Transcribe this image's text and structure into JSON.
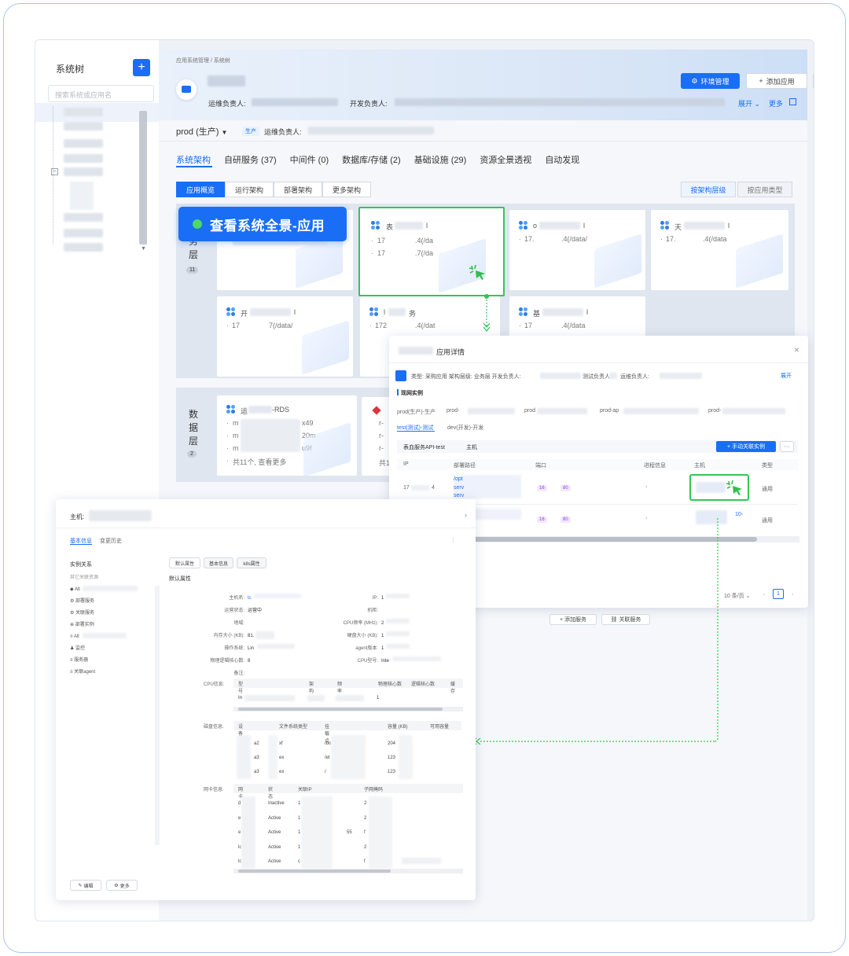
{
  "sidebar": {
    "title": "系统树",
    "add_label": "+",
    "search_placeholder": "搜索系统或应用名"
  },
  "header": {
    "breadcrumb": "应用系统管理 / 系统树",
    "ops_owner_label": "运维负责人:",
    "dev_owner_label": "开发负责人:",
    "env_button": "环境管理",
    "add_app_button": "添加应用",
    "more_button": "···",
    "expand": "展开",
    "more": "更多"
  },
  "env": {
    "name": "prod (生产)",
    "badge": "生产",
    "owner_label": "运维负责人:"
  },
  "tabs": [
    {
      "label": "系统架构",
      "active": true
    },
    {
      "label": "自研服务 (37)"
    },
    {
      "label": "中间件 (0)"
    },
    {
      "label": "数据库/存储 (2)"
    },
    {
      "label": "基础设施 (29)"
    },
    {
      "label": "资源全景透视"
    },
    {
      "label": "自动发现"
    }
  ],
  "subtabs": [
    "应用概览",
    "运行架构",
    "部署架构",
    "更多架构"
  ],
  "view_toggle": [
    "按架构层级",
    "按应用类型"
  ],
  "callout": "查看系统全景-应用",
  "layers": {
    "service": {
      "label_chars": [
        "务",
        "层"
      ],
      "count": "11"
    },
    "data": {
      "label_chars": [
        "数",
        "据",
        "层"
      ],
      "count": "2"
    }
  },
  "tiles": [
    {
      "name": "表",
      "suffix": "l",
      "lines": [
        "17",
        "17"
      ],
      "tails": [
        ".4(/da",
        ".7(/da"
      ]
    },
    {
      "name": "o",
      "suffix": "l",
      "lines": [
        "17."
      ],
      "tails": [
        ".4(/data/"
      ]
    },
    {
      "name": "天",
      "suffix": "l",
      "lines": [
        "17."
      ],
      "tails": [
        ".4(/data"
      ]
    },
    {
      "name": "开",
      "suffix": "l",
      "lines": [
        "17"
      ],
      "tails": [
        "7(/data/"
      ]
    },
    {
      "name": "l",
      "suffix": "务",
      "lines": [
        "172"
      ],
      "tails": [
        ".4(/dat"
      ]
    },
    {
      "name": "基",
      "suffix": "l",
      "lines": [
        "17"
      ],
      "tails": [
        ".4(/data"
      ]
    }
  ],
  "rds_tile": {
    "name": "运",
    "suffix": "-RDS",
    "lines": [
      "m",
      "m",
      "m"
    ],
    "tails": [
      "x49",
      "20m",
      "u9f"
    ],
    "more": "共11个, 查看更多"
  },
  "rds2_tile": {
    "lines": [
      "r-",
      "r-",
      "r-"
    ],
    "more": "共1"
  },
  "app_detail": {
    "title": "应用详情",
    "type_line": "类型: 采购应用  架构层级: 业务层  开发负责人:",
    "test_owner": "测试负责人:",
    "ops_owner": "运维负责人:",
    "expand": "展开",
    "section": "现网实例",
    "envs": [
      "prod(生产)-生产",
      "prod-",
      "prod",
      "prod-ap",
      "prod-"
    ],
    "envs2": [
      "test(测试)-测试",
      "dev(开发)-开发"
    ],
    "filter_label": "表血服务API-test",
    "filter2": "主机",
    "add_instance": "+ 手动关联实例",
    "columns": [
      "IP",
      "部署路径",
      "端口",
      "进程信息",
      "主机",
      "类型"
    ],
    "rows": [
      {
        "ip": "17",
        "ip2": "4",
        "path": [
          "/opt",
          "serv",
          "serv"
        ],
        "ports": [
          "16",
          "80"
        ],
        "type": "通用"
      },
      {
        "ip": "",
        "ip2": "",
        "path": [],
        "ports": [
          "16",
          "80"
        ],
        "type": "通用",
        "host_tail": "10-"
      }
    ],
    "pager": "10 条/页",
    "page": "1",
    "add_service": "+ 添加服务",
    "link_service": "关联服务"
  },
  "host_detail": {
    "title": "主机:",
    "tabs": [
      "基本信息",
      "变更历史"
    ],
    "rel_title": "实例关系",
    "rel_sub": "其它关联资源",
    "rel_items": [
      "Alt",
      "部署服务",
      "关联服务",
      "部署实例",
      "Alt",
      "监控",
      "服务器",
      "关联agent"
    ],
    "attr_tabs": [
      "默认属性",
      "基本信息",
      "k8s属性"
    ],
    "attr_section": "默认属性",
    "fields_left": [
      {
        "k": "主机名:",
        "v": "tc"
      },
      {
        "k": "运营状态:",
        "v": "运营中"
      },
      {
        "k": "地域:",
        "v": ""
      },
      {
        "k": "内存大小 (KB):",
        "v": "81."
      },
      {
        "k": "操作系统:",
        "v": "Lin"
      },
      {
        "k": "物理逻辑核心数:",
        "v": "8"
      },
      {
        "k": "备注:",
        "v": ""
      }
    ],
    "fields_right": [
      {
        "k": "IP:",
        "v": "1"
      },
      {
        "k": "机柜:",
        "v": ""
      },
      {
        "k": "CPU频率 (MHz):",
        "v": "2"
      },
      {
        "k": "硬盘大小 (KB):",
        "v": "1"
      },
      {
        "k": "agent版本:",
        "v": "1"
      },
      {
        "k": "CPU型号:",
        "v": "Inte"
      }
    ],
    "cpu_label": "CPU信息:",
    "cpu_cols": [
      "型号",
      "架构",
      "频率",
      "物理核心数",
      "逻辑核心数",
      "缓存"
    ],
    "cpu_rows": [
      [
        "In",
        "",
        "",
        "1",
        "",
        ""
      ]
    ],
    "disk_label": "磁盘信息:",
    "disk_cols": [
      "设备",
      "文件系统类型",
      "挂载点",
      "容量 (KB)",
      "可用容量"
    ],
    "disk_rows": [
      [
        "a2",
        "xf",
        "/bo",
        "204"
      ],
      [
        "a3",
        "ex",
        "/et",
        "123"
      ],
      [
        "a3",
        "ex",
        "/",
        "123"
      ]
    ],
    "nic_label": "网卡信息:",
    "nic_cols": [
      "网卡",
      "状态",
      "关联IP",
      "子网掩码"
    ],
    "nic_rows": [
      [
        "d",
        "Inactive",
        "1",
        "2"
      ],
      [
        "e",
        "Active",
        "1",
        "2"
      ],
      [
        "e",
        "Active",
        "1",
        "f"
      ],
      [
        "lc",
        "Active",
        "1",
        "2"
      ],
      [
        "lc",
        "Active",
        "c",
        "f"
      ]
    ],
    "nic_extra": [
      "55"
    ],
    "edit": "编辑",
    "more": "更多"
  }
}
